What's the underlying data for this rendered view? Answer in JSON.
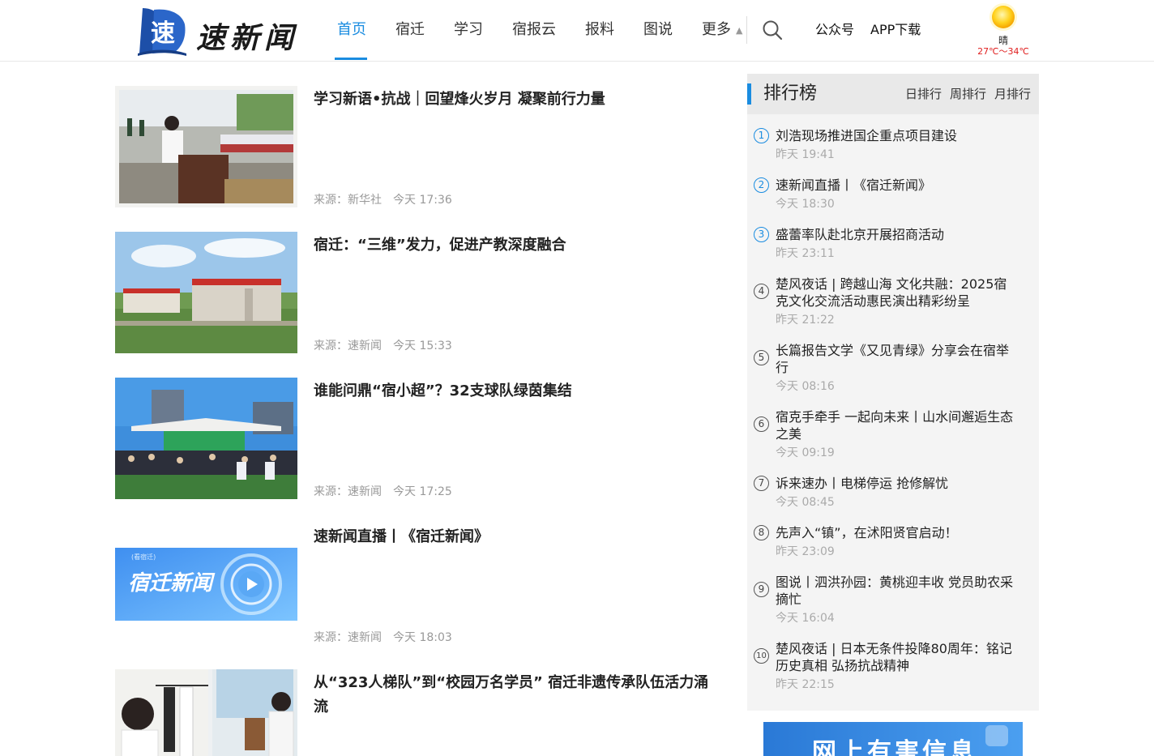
{
  "header": {
    "logo_text": "速新闻",
    "logo_glyph": "速",
    "nav": [
      {
        "label": "首页",
        "active": true
      },
      {
        "label": "宿迁"
      },
      {
        "label": "学习"
      },
      {
        "label": "宿报云"
      },
      {
        "label": "报料"
      },
      {
        "label": "图说"
      },
      {
        "label": "更多"
      }
    ],
    "more_arrow": "▲",
    "links": {
      "gongzhonghao": "公众号",
      "app": "APP下载"
    },
    "weather": {
      "desc": "晴",
      "temp": "27℃～34℃",
      "icon": "sun-icon"
    },
    "accent": "#1a8ce0"
  },
  "news": [
    {
      "title": "学习新语•抗战｜回望烽火岁月 凝聚前行力量",
      "source": "来源：新华社",
      "time": "今天 17:36"
    },
    {
      "title": "宿迁：“三维”发力，促进产教深度融合",
      "source": "来源：速新闻",
      "time": "今天 15:33"
    },
    {
      "title": "谁能问鼎“宿小超”？32支球队绿茵集结",
      "source": "来源：速新闻",
      "time": "今天 17:25"
    },
    {
      "title": "速新闻直播丨《宿迁新闻》",
      "source": "来源：速新闻",
      "time": "今天 18:03",
      "thumb_text": "宿迁新闻",
      "thumb_tag": "(看宿迁)"
    },
    {
      "title": "从“323人梯队”到“校园万名学员” 宿迁非遗传承队伍活力涌流",
      "source": "",
      "time": ""
    }
  ],
  "ranking": {
    "title": "排行榜",
    "tabs": [
      "日排行",
      "周排行",
      "月排行"
    ],
    "items": [
      {
        "num": "1",
        "title": "刘浩现场推进国企重点项目建设",
        "time": "昨天 19:41"
      },
      {
        "num": "2",
        "title": "速新闻直播丨《宿迁新闻》",
        "time": "今天 18:30"
      },
      {
        "num": "3",
        "title": "盛蕾率队赴北京开展招商活动",
        "time": "昨天 23:11"
      },
      {
        "num": "4",
        "title": "楚风夜话 | 跨越山海 文化共融：2025宿克文化交流活动惠民演出精彩纷呈",
        "time": "昨天 21:22"
      },
      {
        "num": "5",
        "title": "长篇报告文学《又见青绿》分享会在宿举行",
        "time": "今天 08:16"
      },
      {
        "num": "6",
        "title": "宿克手牵手 一起向未来丨山水间邂逅生态之美",
        "time": "今天 09:19"
      },
      {
        "num": "7",
        "title": "诉来速办丨电梯停运 抢修解忧",
        "time": "今天 08:45"
      },
      {
        "num": "8",
        "title": "先声入“镇”，在沭阳贤官启动！",
        "time": "昨天 23:09"
      },
      {
        "num": "9",
        "title": "图说丨泗洪孙园：黄桃迎丰收 党员助农采摘忙",
        "time": "今天 16:04"
      },
      {
        "num": "10",
        "title": "楚风夜话 | 日本无条件投降80周年：铭记历史真相 弘扬抗战精神",
        "time": "昨天 22:15"
      }
    ]
  },
  "banner": {
    "text": "网上有害信息"
  }
}
